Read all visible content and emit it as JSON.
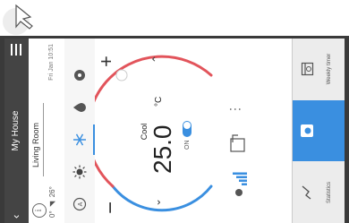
{
  "header": {
    "title": "My House",
    "back_icon": "‹"
  },
  "room": {
    "name": "Living Room",
    "weather_temp": "0°",
    "weather_humidity": "26°",
    "date": "Fri Jan 10:51"
  },
  "thermostat": {
    "mode": "Cool",
    "setpoint": "25.0",
    "unit": "°C",
    "power_label": "ON",
    "plus": "+",
    "minus": "−",
    "more": "⋮"
  },
  "footer": {
    "tabs": [
      {
        "label": "Statistics"
      },
      {
        "label": ""
      },
      {
        "label": "Weekly timer"
      }
    ]
  },
  "colors": {
    "accent": "#3a8fe0",
    "arc_warm": "#e2545b",
    "arc_cool": "#3a8fe0",
    "header": "#444444"
  },
  "icons": [
    "pointer-arrow-icon",
    "menu-icon",
    "info-icon",
    "auto-mode-icon",
    "sun-icon",
    "snowflake-icon",
    "drop-icon",
    "fan-mode-icon",
    "plus-icon",
    "minus-icon",
    "fan-speed-icon",
    "more-icon",
    "hold-icon",
    "statistics-icon",
    "thermostat-icon",
    "weekly-timer-icon"
  ]
}
